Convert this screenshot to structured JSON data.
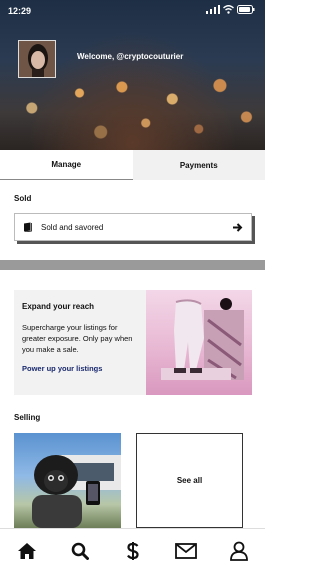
{
  "status_bar": {
    "time": "12:29"
  },
  "header": {
    "welcome": "Welcome, @cryptocouturier"
  },
  "tabs": [
    {
      "label": "Manage"
    },
    {
      "label": "Payments"
    }
  ],
  "sold": {
    "title": "Sold",
    "card_label": "Sold and savored",
    "icons": {
      "leading": "book-icon",
      "trailing": "arrow-right-icon"
    }
  },
  "promo": {
    "title": "Expand your reach",
    "body": "Supercharge your listings for greater exposure. Only pay when you make a sale.",
    "link": "Power up your listings"
  },
  "selling": {
    "title": "Selling",
    "see_all": "See all"
  },
  "bottom_nav": {
    "icons": [
      "home-icon",
      "search-icon",
      "dollar-icon",
      "mail-icon",
      "profile-icon"
    ]
  },
  "colors": {
    "link": "#1a2a6e",
    "divider": "#9a9a9a",
    "promo_bg": "#f2f2f2"
  }
}
